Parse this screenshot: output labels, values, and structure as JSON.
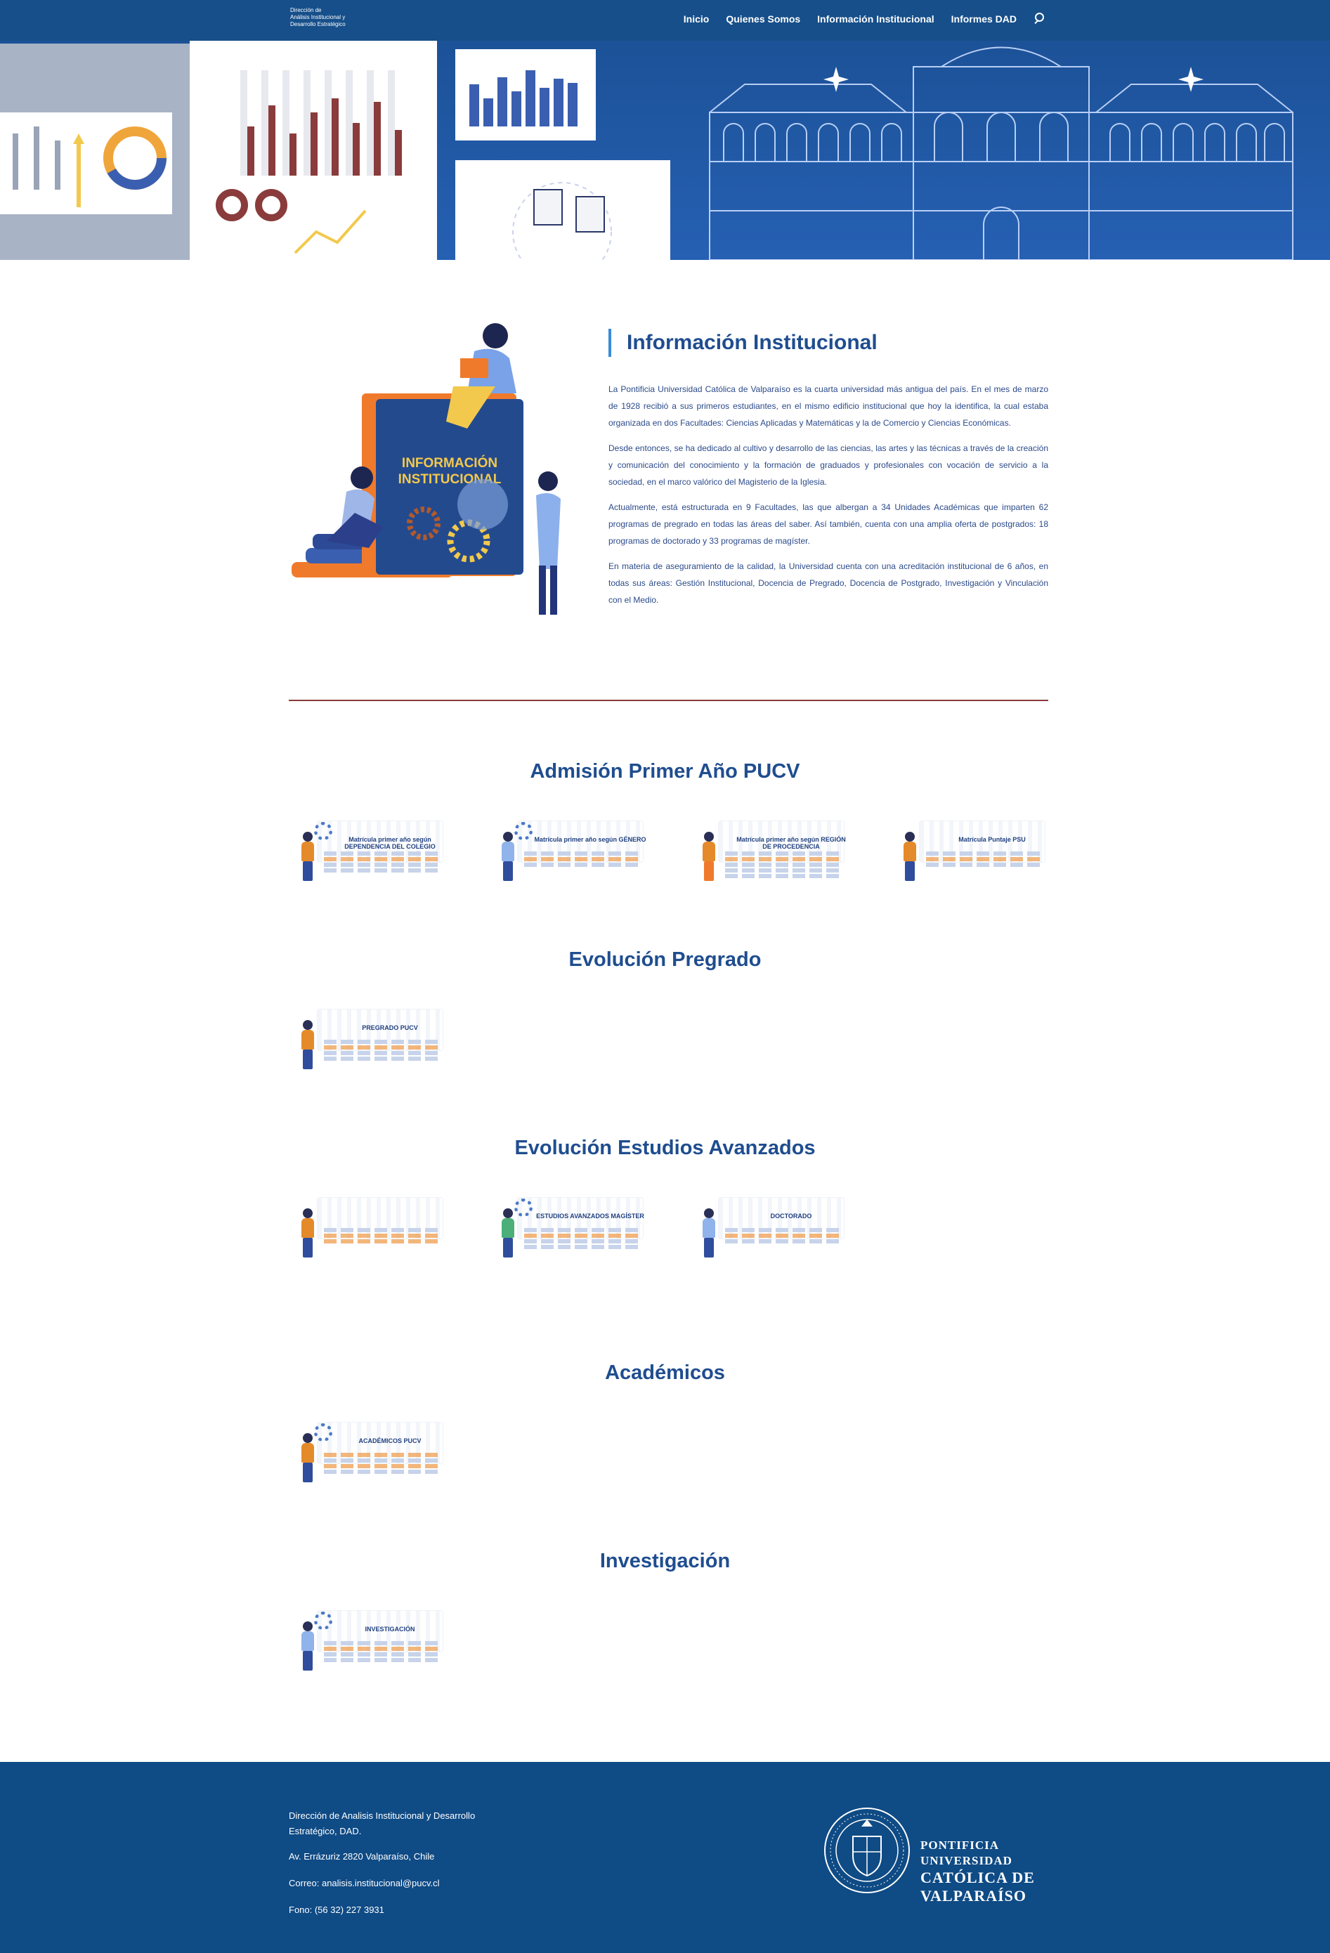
{
  "header": {
    "logo_lines": [
      "Dirección de",
      "Análisis Institucional y",
      "Desarrollo Estratégico"
    ],
    "nav": [
      "Inicio",
      "Quienes Somos",
      "Información Institucional",
      "Informes DAD"
    ]
  },
  "hero": {
    "illustration": "data-analysis-and-university-building"
  },
  "intro": {
    "book_text_1": "INFORMACIÓN",
    "book_text_2": "INSTITUCIONAL",
    "title": "Información Institucional",
    "paragraphs": [
      "La Pontificia Universidad Católica de Valparaíso es la cuarta universidad más antigua del país. En el mes de marzo de 1928 recibió a sus primeros estudiantes, en el mismo edificio institucional que hoy la identifica, la cual estaba organizada en dos Facultades: Ciencias Aplicadas y Matemáticas y la de Comercio y Ciencias Económicas.",
      "Desde entonces, se ha dedicado al cultivo y desarrollo de las ciencias, las artes y las técnicas a través de la creación y comunicación del conocimiento y la formación de graduados y profesionales con vocación de servicio a la sociedad, en el marco valórico del Magisterio de la Iglesia.",
      "Actualmente, está estructurada en 9 Facultades, las que albergan a 34 Unidades Académicas que imparten 62 programas de pregrado en todas las áreas del saber. Así también, cuenta con una amplia oferta de postgrados: 18 programas de doctorado y 33 programas de magíster.",
      "En materia de aseguramiento de la calidad, la Universidad cuenta con una acreditación institucional de 6 años, en todas sus áreas: Gestión Institucional, Docencia de Pregrado, Docencia de Postgrado, Investigación y Vinculación con el Medio."
    ]
  },
  "sections": [
    {
      "title": "Admisión Primer Año PUCV",
      "cards": [
        {
          "title": "Matrícula primer año según DEPENDENCIA DEL COLEGIO"
        },
        {
          "title": "Matrícula primer año según GÉNERO"
        },
        {
          "title": "Matrícula primer año según REGIÓN DE PROCEDENCIA"
        },
        {
          "title": "Matrícula Puntaje PSU"
        }
      ]
    },
    {
      "title": "Evolución Pregrado",
      "cards": [
        {
          "title": "PREGRADO PUCV"
        }
      ]
    },
    {
      "title": "Evolución Estudios Avanzados",
      "cards": [
        {
          "title": ""
        },
        {
          "title": "ESTUDIOS AVANZADOS MAGÍSTER"
        },
        {
          "title": "DOCTORADO"
        }
      ]
    },
    {
      "title": "Académicos",
      "cards": [
        {
          "title": "ACADÉMICOS PUCV"
        }
      ]
    },
    {
      "title": "Investigación",
      "cards": [
        {
          "title": "INVESTIGACIÓN"
        }
      ]
    }
  ],
  "footer": {
    "org": "Dirección de Analisis Institucional y Desarrollo Estratégico, DAD.",
    "address": "Av. Errázuriz 2820 Valparaíso, Chile",
    "email": "Correo: analisis.institucional@pucv.cl",
    "phone": "Fono: (56 32) 227 3931",
    "uni_line1": "PONTIFICIA",
    "uni_line2": "UNIVERSIDAD",
    "uni_line3": "CATÓLICA DE",
    "uni_line4": "VALPARAÍSO"
  },
  "colors": {
    "primary": "#164f8a",
    "heading": "#1f4d8f",
    "accent": "#3a8bd8",
    "divider": "#8a3a3a",
    "footer": "#0f4b85"
  }
}
